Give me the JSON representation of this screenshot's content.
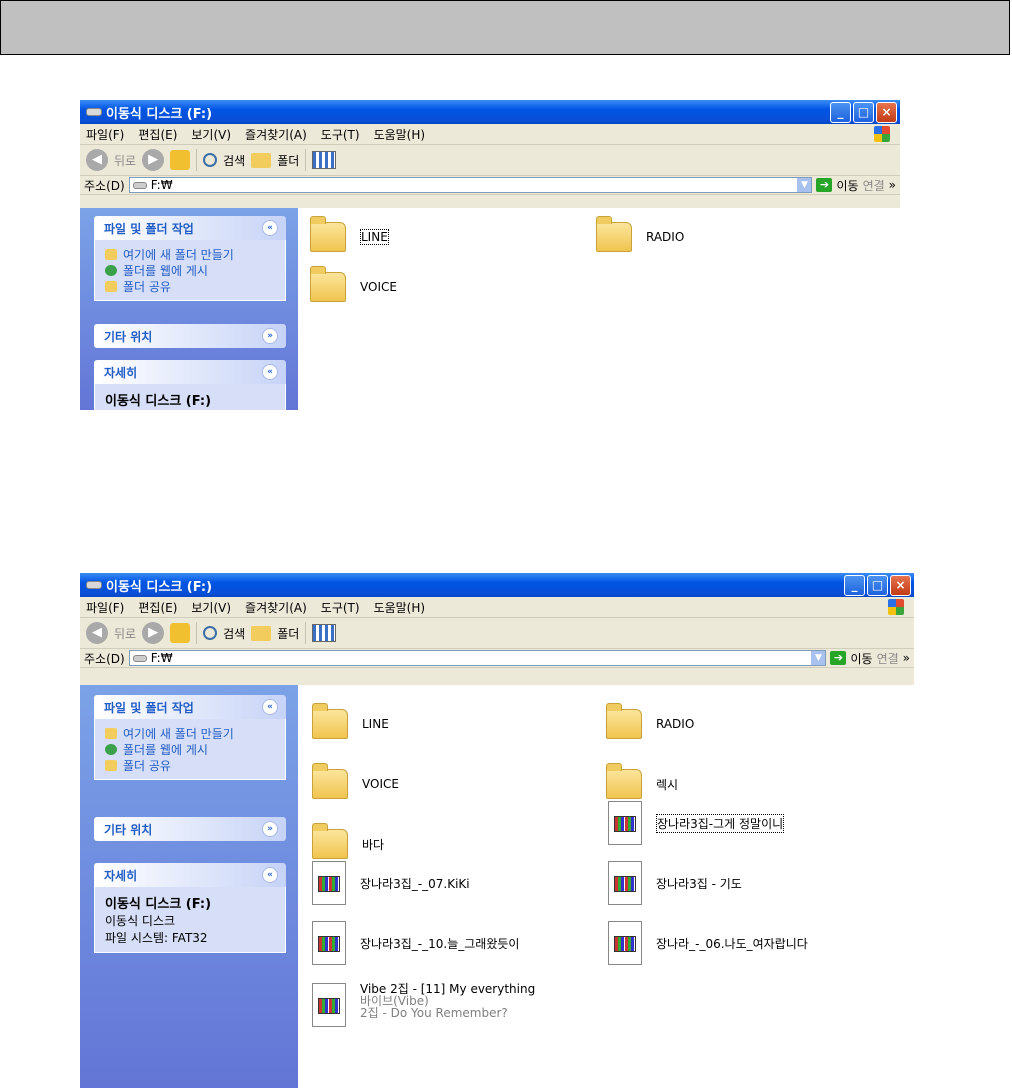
{
  "window_title": "이동식 디스크 (F:)",
  "menus": [
    "파일(F)",
    "편집(E)",
    "보기(V)",
    "즐겨찾기(A)",
    "도구(T)",
    "도움말(H)"
  ],
  "toolbar": {
    "back": "뒤로",
    "search": "검색",
    "folders": "폴더"
  },
  "address": {
    "label": "주소(D)",
    "path": "F:₩",
    "go": "이동",
    "links": "연결",
    "more": "»"
  },
  "title_buttons": {
    "minimize": "_",
    "maximize": "□",
    "close": "×"
  },
  "chevrons": {
    "up": "«",
    "down": "»"
  },
  "taskpane": {
    "file_tasks_title": "파일 및 폴더 작업",
    "tasks": [
      "여기에 새 폴더 만들기",
      "폴더를 웹에 게시",
      "폴더 공유"
    ],
    "other_places_title": "기타 위치",
    "details_title": "자세히",
    "details_name": "이동식 디스크 (F:)",
    "details_type": "이동식 디스크",
    "details_fs": "파일 시스템: FAT32"
  },
  "window1_items": [
    "LINE",
    "RADIO",
    "VOICE"
  ],
  "window2_items": [
    "LINE",
    "RADIO",
    "VOICE",
    "렉시",
    "바다",
    "장나라3집-그게 정말이니",
    "장나라3집_-_07.KiKi",
    "장나라3집 - 기도",
    "장나라3집_-_10.늘_그래왔듯이",
    "장나라_-_06.나도_여자랍니다"
  ],
  "window2_last": {
    "name": "Vibe 2집 - [11] My everything",
    "artist": "바이브(Vibe)",
    "album": "2집 - Do You Remember?"
  },
  "icons": [
    "disk-icon",
    "folder-icon",
    "audio-file-icon",
    "windows-logo-icon",
    "search-icon",
    "back-icon",
    "forward-icon",
    "up-icon",
    "views-icon",
    "go-icon"
  ]
}
